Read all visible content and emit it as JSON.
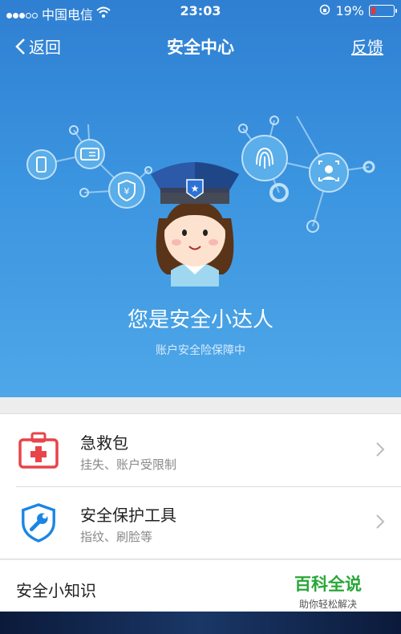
{
  "status_bar": {
    "carrier": "中国电信",
    "time": "23:03",
    "battery": "19%"
  },
  "nav": {
    "back_label": "返回",
    "title": "安全中心",
    "feedback_label": "反馈"
  },
  "hero": {
    "title": "您是安全小达人",
    "subtitle": "账户安全险保障中"
  },
  "items": [
    {
      "title": "急救包",
      "subtitle": "挂失、账户受限制",
      "icon": "first-aid-kit-icon"
    },
    {
      "title": "安全保护工具",
      "subtitle": "指纹、刷脸等",
      "icon": "shield-wrench-icon"
    }
  ],
  "knowledge": {
    "label": "安全小知识"
  },
  "watermark": {
    "brand": "百科全说",
    "slogan": "助你轻松解决"
  },
  "colors": {
    "hero_top": "#2f7fd2",
    "hero_bottom": "#4ea7e8",
    "kit_red": "#e8444a",
    "shield_blue": "#1a86e3",
    "watermark_green": "#27a737"
  }
}
